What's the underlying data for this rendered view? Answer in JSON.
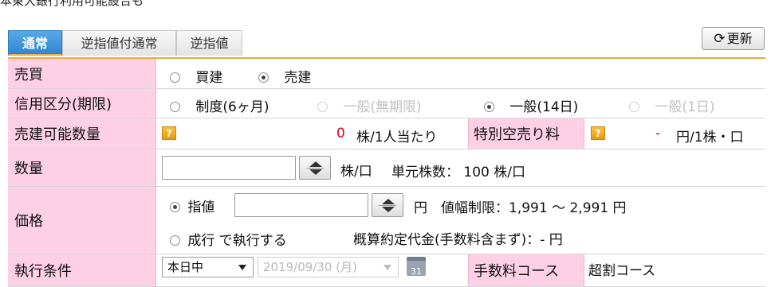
{
  "top_note": "本東大銀行利用可能設合も",
  "tabs": [
    {
      "label": "通常",
      "active": true
    },
    {
      "label": "逆指値付通常",
      "active": false
    },
    {
      "label": "逆指値",
      "active": false
    }
  ],
  "refresh": {
    "icon": "refresh-icon",
    "label": "更新"
  },
  "rows": {
    "baibai": {
      "label": "売買",
      "options": [
        {
          "label": "買建",
          "checked": false,
          "disabled": false
        },
        {
          "label": "売建",
          "checked": true,
          "disabled": false
        }
      ]
    },
    "shinyo": {
      "label": "信用区分(期限)",
      "options": [
        {
          "label": "制度(6ヶ月)",
          "checked": false,
          "disabled": false
        },
        {
          "label": "一般(無期限)",
          "checked": false,
          "disabled": true
        },
        {
          "label": "一般(14日)",
          "checked": true,
          "disabled": false
        },
        {
          "label": "一般(1日)",
          "checked": false,
          "disabled": true
        }
      ]
    },
    "kanou": {
      "label": "売建可能数量",
      "help": "?",
      "value": "0",
      "unit": "株/1人当たり",
      "label2": "特別空売り料",
      "help2": "?",
      "value2": "-",
      "unit2": "円/1株・口"
    },
    "suryo": {
      "label": "数量",
      "value": "",
      "unit": "株/口",
      "tanigen": "単元株数： 100 株/口"
    },
    "kakaku": {
      "label": "価格",
      "sashine_label": "指値",
      "sashine_checked": true,
      "value": "",
      "unit": "円",
      "limit": "値幅制限：1,991 〜 2,991 円",
      "nariyuki_label": "成行 で執行する",
      "nariyuki_checked": false,
      "gaisan": "概算約定代金(手数料含まず)：- 円"
    },
    "shikko": {
      "label": "執行条件",
      "condition": "本日中",
      "date": "2019/09/30 (月)",
      "calendar_label": "31",
      "label2": "手数料コース",
      "course": "超割コース"
    }
  },
  "colors": {
    "label_bg": "#fdd0e6",
    "accent": "#f2a93b",
    "tab_active": "#2f86d3",
    "red": "#e0001b"
  }
}
